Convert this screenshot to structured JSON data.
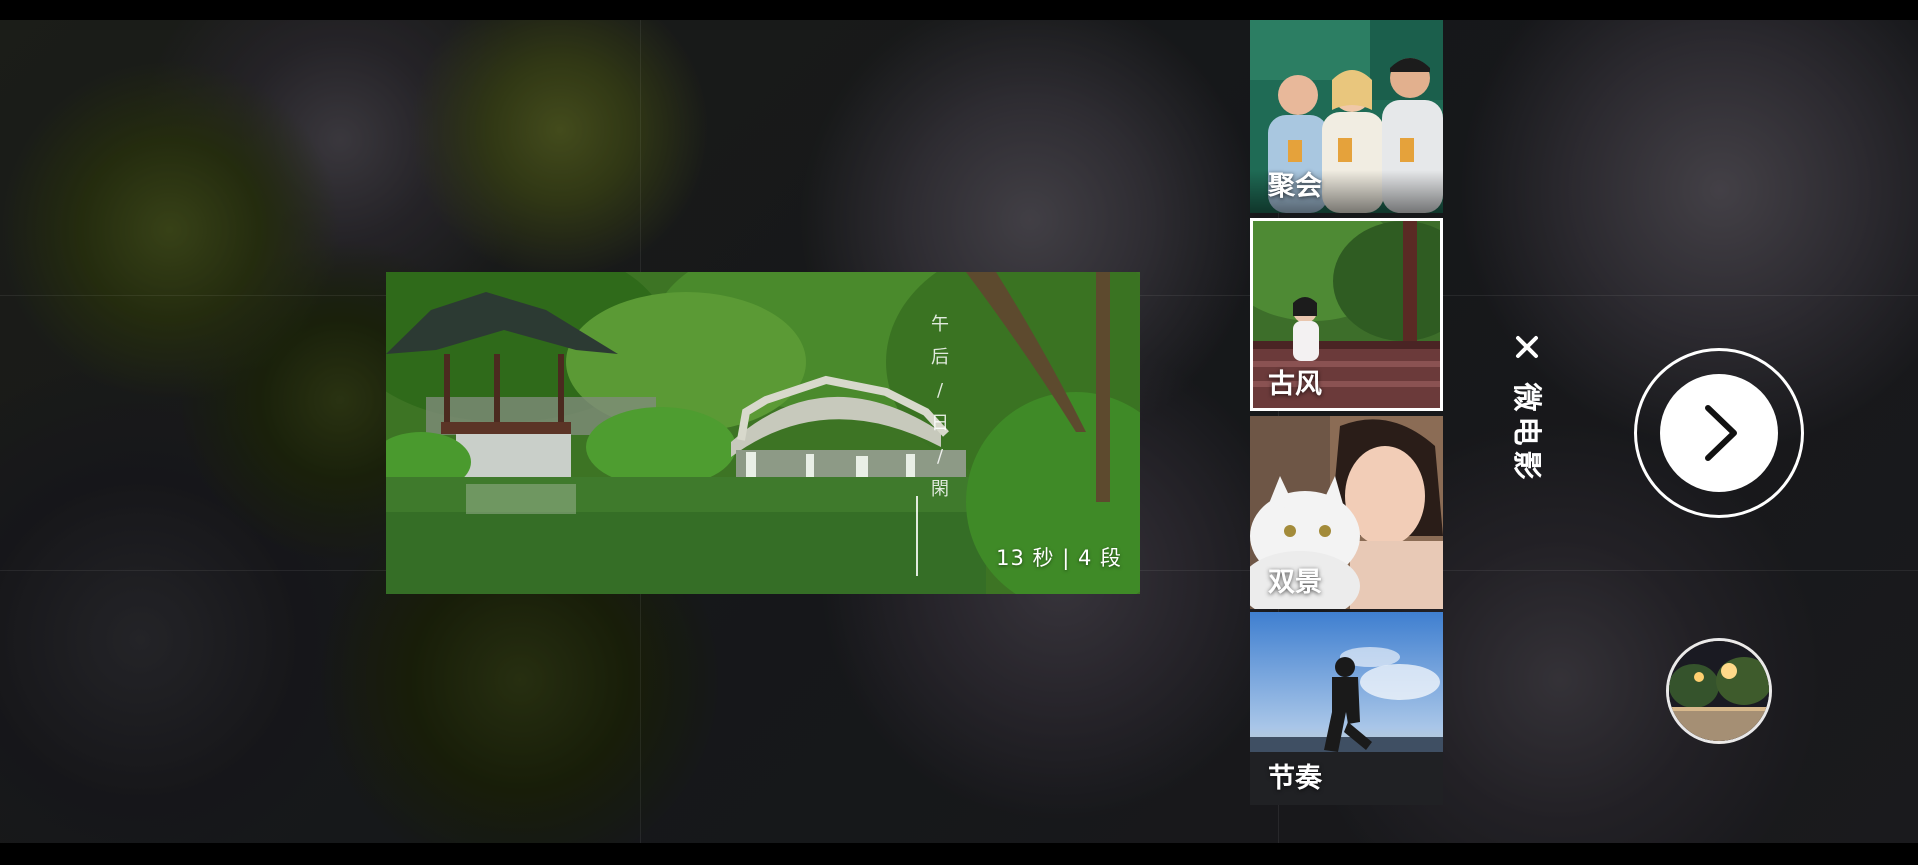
{
  "preview": {
    "vertical_text": [
      "午",
      "后",
      "/",
      "日",
      "/",
      "閑"
    ],
    "meta": "13 秒 | 4 段"
  },
  "templates": [
    {
      "label": "聚会",
      "selected": false
    },
    {
      "label": "古风",
      "selected": true
    },
    {
      "label": "双景",
      "selected": false
    },
    {
      "label": "节奏",
      "selected": false
    }
  ],
  "mode": {
    "label": "微电影",
    "close_icon": "close-icon"
  },
  "next_button": {
    "icon": "chevron-right-icon"
  },
  "gallery_thumbnail": {
    "icon": "gallery-thumbnail"
  },
  "colors": {
    "background": "#000000",
    "selected_border": "#ffffff",
    "text": "#ffffff"
  }
}
